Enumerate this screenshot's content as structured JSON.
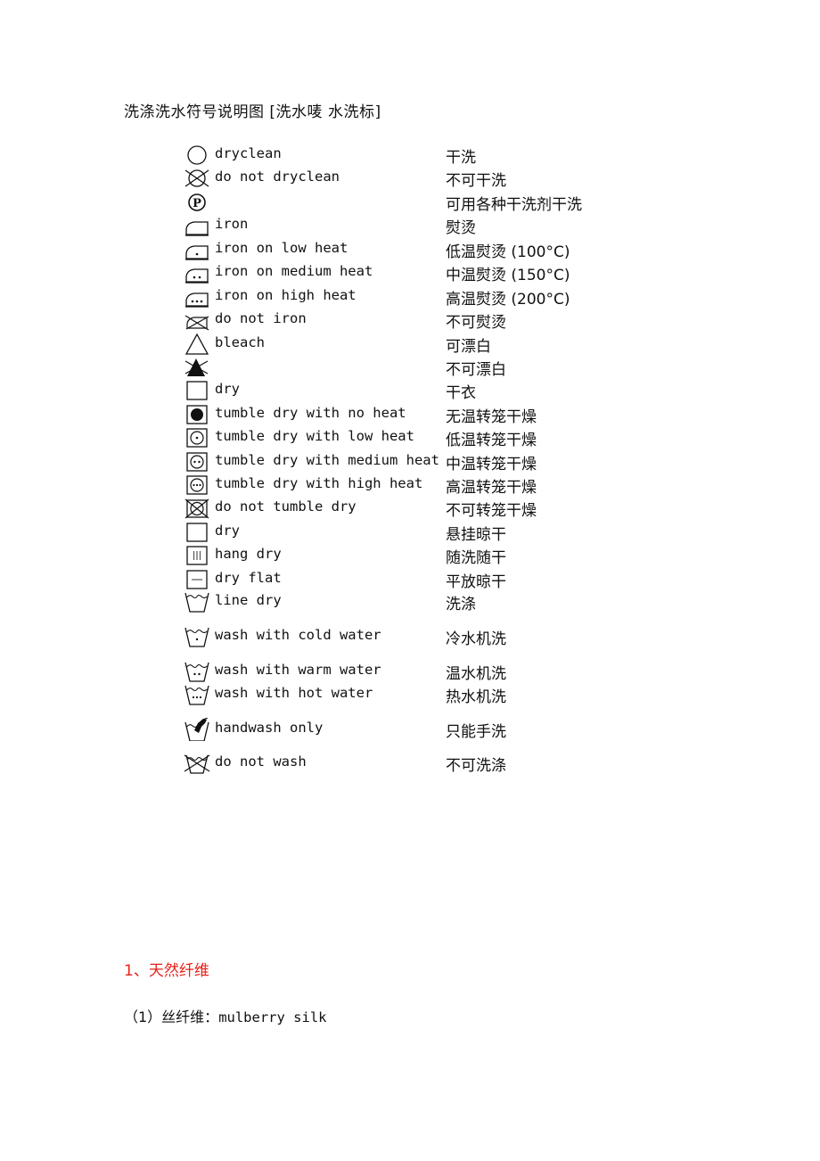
{
  "document": {
    "title": "洗涤洗水符号说明图 [洗水唛 水洗标]",
    "symbols": [
      {
        "icon": "dryclean-circle-icon",
        "en": "dryclean",
        "zh": "干洗"
      },
      {
        "icon": "do-not-dryclean-icon",
        "en": "do not dryclean",
        "zh": "不可干洗"
      },
      {
        "icon": "dryclean-p-circle-icon",
        "en": "",
        "zh": "可用各种干洗剂干洗"
      },
      {
        "icon": "iron-icon",
        "en": "iron",
        "zh": "熨烫"
      },
      {
        "icon": "iron-low-heat-icon",
        "en": "iron on low heat",
        "zh": "低温熨烫 (100°C)"
      },
      {
        "icon": "iron-medium-heat-icon",
        "en": "iron on medium heat",
        "zh": "中温熨烫 (150°C)"
      },
      {
        "icon": "iron-high-heat-icon",
        "en": "iron on high heat",
        "zh": "高温熨烫 (200°C)"
      },
      {
        "icon": "do-not-iron-icon",
        "en": "do not iron",
        "zh": "不可熨烫"
      },
      {
        "icon": "bleach-triangle-icon",
        "en": "bleach",
        "zh": "可漂白"
      },
      {
        "icon": "do-not-bleach-icon",
        "en": "",
        "zh": "不可漂白"
      },
      {
        "icon": "dry-square-icon",
        "en": "dry",
        "zh": "干衣"
      },
      {
        "icon": "tumble-dry-no-heat-icon",
        "en": "tumble dry with no heat",
        "zh": "无温转笼干燥"
      },
      {
        "icon": "tumble-dry-low-heat-icon",
        "en": "tumble dry with low heat",
        "zh": "低温转笼干燥"
      },
      {
        "icon": "tumble-dry-medium-heat-icon",
        "en": "tumble dry with medium heat",
        "zh": "中温转笼干燥"
      },
      {
        "icon": "tumble-dry-high-heat-icon",
        "en": "tumble dry with high heat",
        "zh": "高温转笼干燥"
      },
      {
        "icon": "do-not-tumble-dry-icon",
        "en": "do not tumble dry",
        "zh": "不可转笼干燥"
      },
      {
        "icon": "dry-square-icon",
        "en": "dry",
        "zh": "悬挂晾干"
      },
      {
        "icon": "hang-dry-icon",
        "en": "hang dry",
        "zh": "随洗随干"
      },
      {
        "icon": "dry-flat-icon",
        "en": "dry flat",
        "zh": "平放晾干"
      },
      {
        "icon": "wash-tub-icon",
        "en": "line dry",
        "zh": "洗涤"
      },
      {
        "icon": "wash-cold-icon",
        "en": "wash with cold water",
        "zh": "冷水机洗"
      },
      {
        "icon": "wash-warm-icon",
        "en": "wash with warm water",
        "zh": "温水机洗"
      },
      {
        "icon": "wash-hot-icon",
        "en": "wash with hot water",
        "zh": "热水机洗"
      },
      {
        "icon": "handwash-icon",
        "en": "handwash only",
        "zh": "只能手洗"
      },
      {
        "icon": "do-not-wash-icon",
        "en": "do not wash",
        "zh": "不可洗涤"
      }
    ],
    "section_heading": "1、天然纤维",
    "section_heading_color": "#e8201a",
    "subheading_prefix": "（1）丝纤维：",
    "subheading_term": "mulberry silk"
  }
}
